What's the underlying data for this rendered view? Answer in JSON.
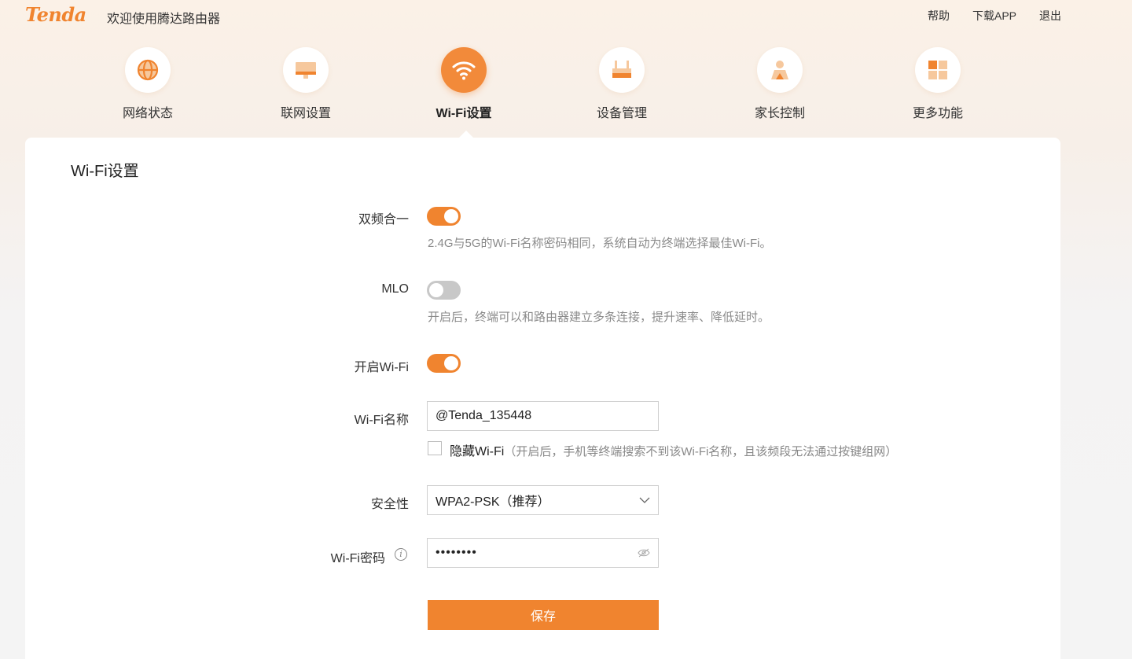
{
  "header": {
    "logo": "Tenda",
    "welcome": "欢迎使用腾达路由器",
    "links": [
      "帮助",
      "下载APP",
      "退出"
    ]
  },
  "nav": {
    "items": [
      {
        "label": "网络状态",
        "icon": "globe-icon"
      },
      {
        "label": "联网设置",
        "icon": "monitor-icon"
      },
      {
        "label": "Wi-Fi设置",
        "icon": "wifi-icon",
        "active": true
      },
      {
        "label": "设备管理",
        "icon": "router-icon"
      },
      {
        "label": "家长控制",
        "icon": "parent-icon"
      },
      {
        "label": "更多功能",
        "icon": "grid-icon"
      }
    ]
  },
  "card": {
    "title": "Wi-Fi设置",
    "dual_band": {
      "label": "双频合一",
      "enabled": true,
      "hint": "2.4G与5G的Wi-Fi名称密码相同，系统自动为终端选择最佳Wi-Fi。"
    },
    "mlo": {
      "label": "MLO",
      "enabled": false,
      "hint": "开启后，终端可以和路由器建立多条连接，提升速率、降低延时。"
    },
    "wifi_enable": {
      "label": "开启Wi-Fi",
      "enabled": true
    },
    "wifi_name": {
      "label": "Wi-Fi名称",
      "value": "@Tenda_135448"
    },
    "hide_wifi": {
      "label": "隐藏Wi-Fi",
      "note": "（开启后，手机等终端搜索不到该Wi-Fi名称，且该频段无法通过按键组网）",
      "checked": false
    },
    "security": {
      "label": "安全性",
      "value": "WPA2-PSK（推荐）"
    },
    "password": {
      "label": "Wi-Fi密码",
      "value": "••••••••"
    },
    "save_label": "保存"
  },
  "colors": {
    "accent": "#f0842f"
  }
}
